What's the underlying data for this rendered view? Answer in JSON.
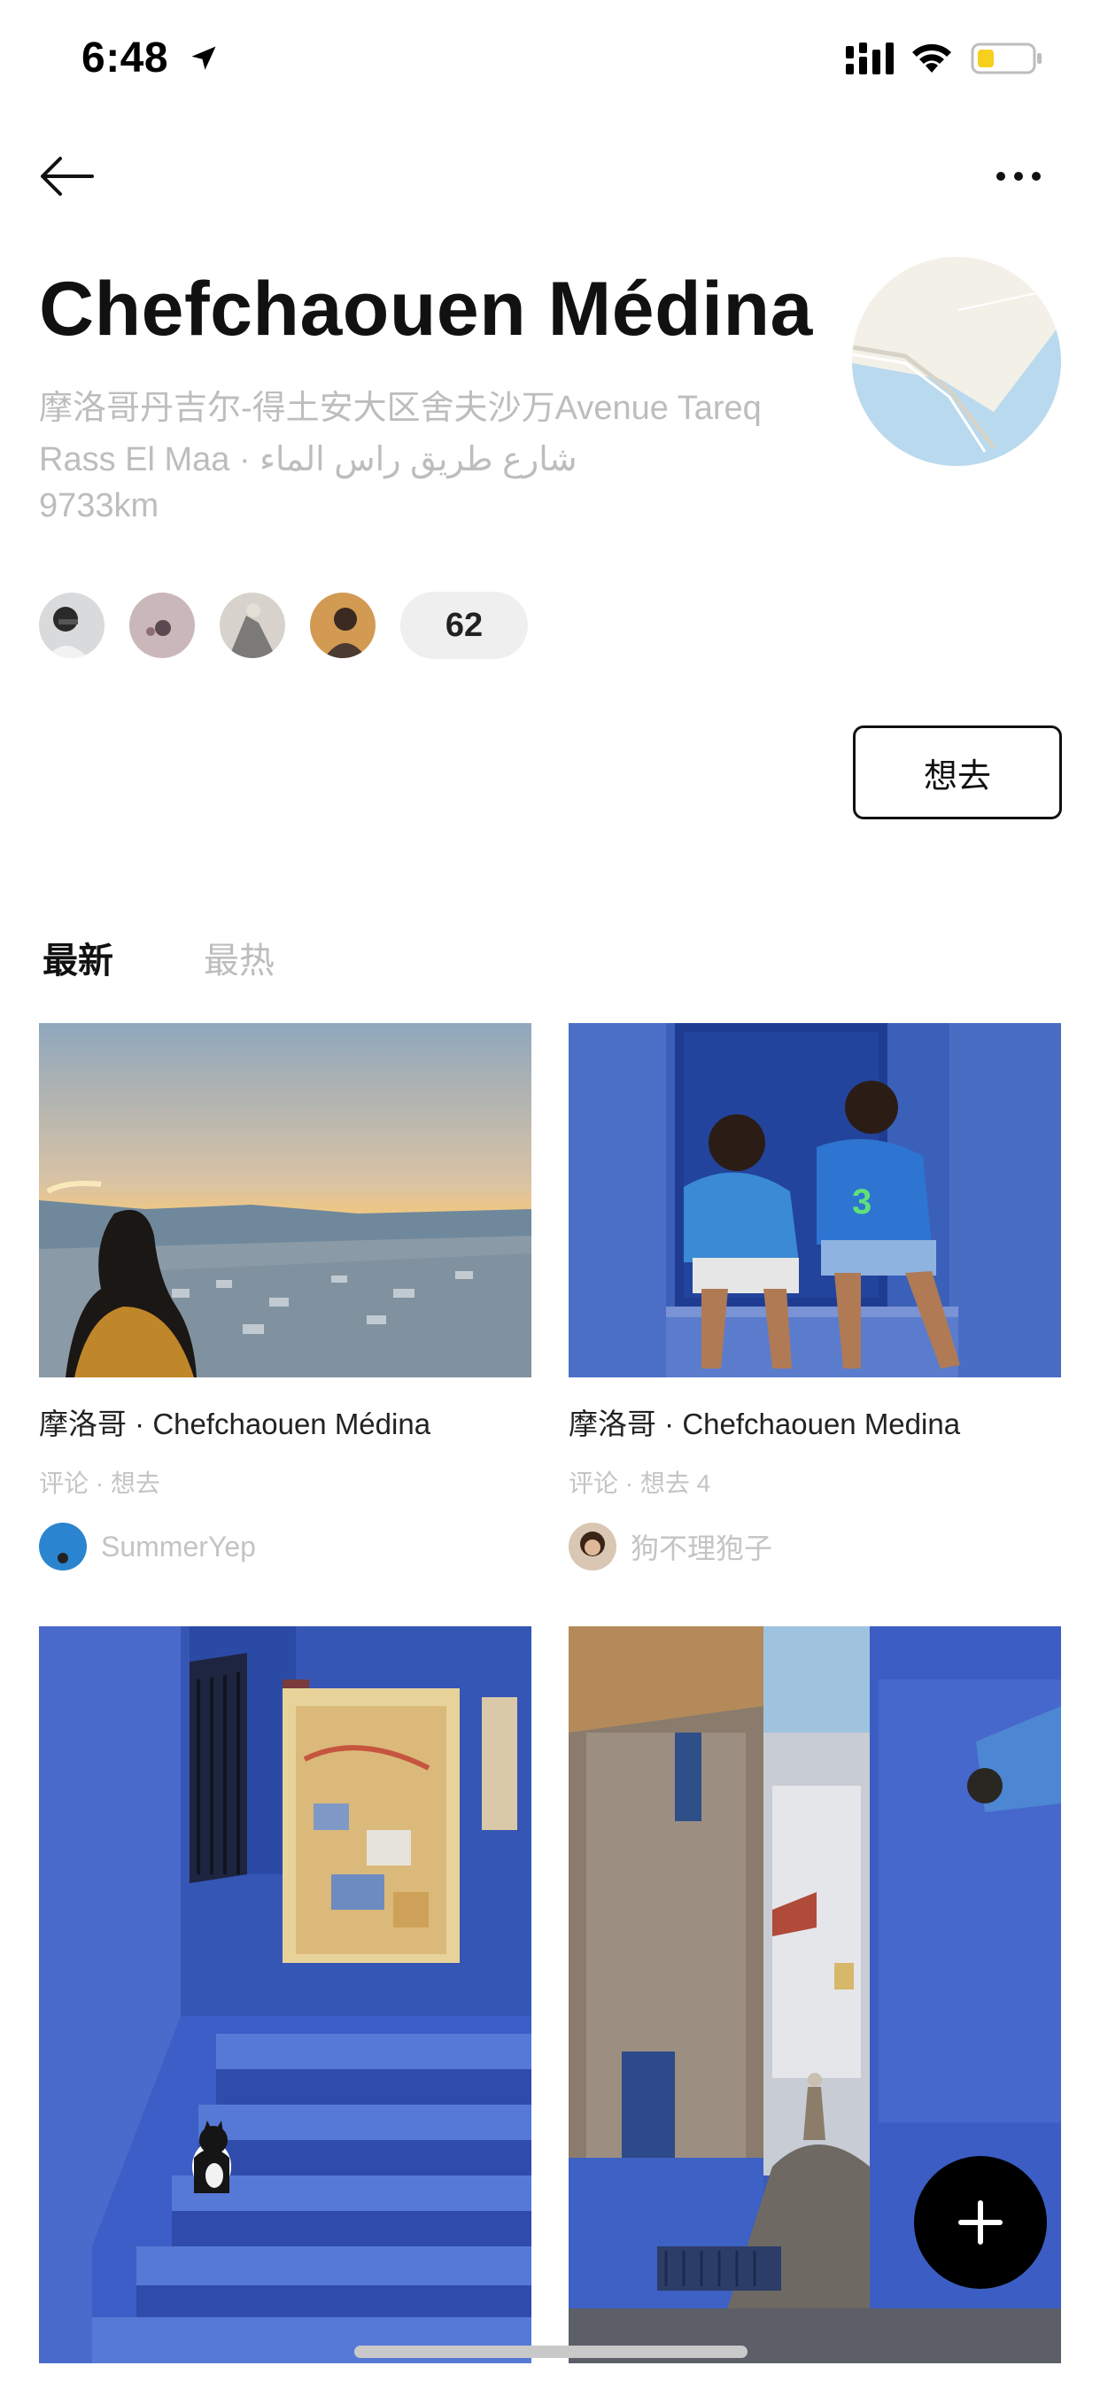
{
  "status_bar": {
    "time": "6:48",
    "battery_color": "#f7cf1d"
  },
  "nav": {
    "back_icon": "arrow-left-icon",
    "more_icon": "more-horizontal-icon"
  },
  "place": {
    "title": "Chefchaouen Médina",
    "address": "摩洛哥丹吉尔-得土安大区舍夫沙万Avenue Tareq Rass El Maa · ⁦الماء‎⁩ شارع طريق راس",
    "distance": "9733km"
  },
  "visitors": {
    "count": "62"
  },
  "actions": {
    "want_label": "想去"
  },
  "tabs": [
    {
      "label": "最新",
      "active": true
    },
    {
      "label": "最热",
      "active": false
    }
  ],
  "cards": [
    {
      "title": "摩洛哥 · Chefchaouen Médina",
      "meta": "评论 · 想去",
      "author": "SummerYep"
    },
    {
      "title": "摩洛哥 · Chefchaouen Medina",
      "meta": "评论 · 想去 4",
      "author": "狗不理狍子"
    },
    {
      "title": "",
      "meta": "",
      "author": ""
    },
    {
      "title": "",
      "meta": "",
      "author": ""
    }
  ],
  "fab": {
    "icon": "plus-icon"
  }
}
